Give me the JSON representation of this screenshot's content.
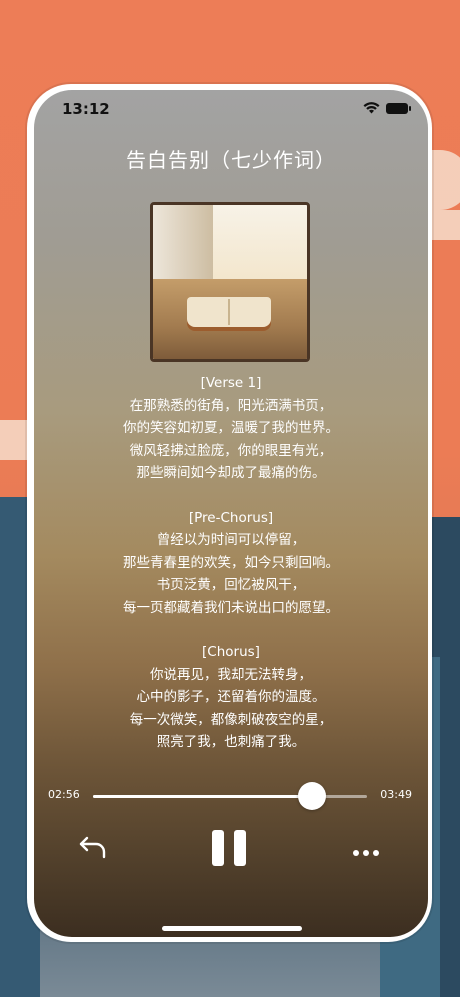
{
  "status_bar": {
    "time": "13:12",
    "icons": [
      "wifi-icon",
      "battery-icon"
    ]
  },
  "song": {
    "title": "告白告别（七少作词）",
    "cover_icon": "album-cover-image"
  },
  "lyrics": {
    "verse1_tag": "[Verse 1]",
    "verse1": [
      "在那熟悉的街角，阳光洒满书页，",
      "你的笑容如初夏，温暖了我的世界。",
      "微风轻拂过脸庞，你的眼里有光，",
      "那些瞬间如今却成了最痛的伤。"
    ],
    "prechorus_tag": "[Pre-Chorus]",
    "prechorus": [
      "曾经以为时间可以停留，",
      "那些青春里的欢笑，如今只剩回响。",
      "书页泛黄，回忆被风干，",
      "每一页都藏着我们未说出口的愿望。"
    ],
    "chorus_tag": "[Chorus]",
    "chorus": [
      "你说再见，我却无法转身，",
      "心中的影子，还留着你的温度。",
      "每一次微笑，都像刺破夜空的星，",
      "照亮了我，也刺痛了我。"
    ]
  },
  "player": {
    "elapsed": "02:56",
    "total": "03:49",
    "progress_fraction": 0.8,
    "controls": {
      "back_icon": "back-arrow-icon",
      "pause_icon": "pause-icon",
      "more_icon": "more-horizontal-icon"
    }
  },
  "colors": {
    "accent": "#ffffff",
    "background_top": "#ed7d57"
  }
}
